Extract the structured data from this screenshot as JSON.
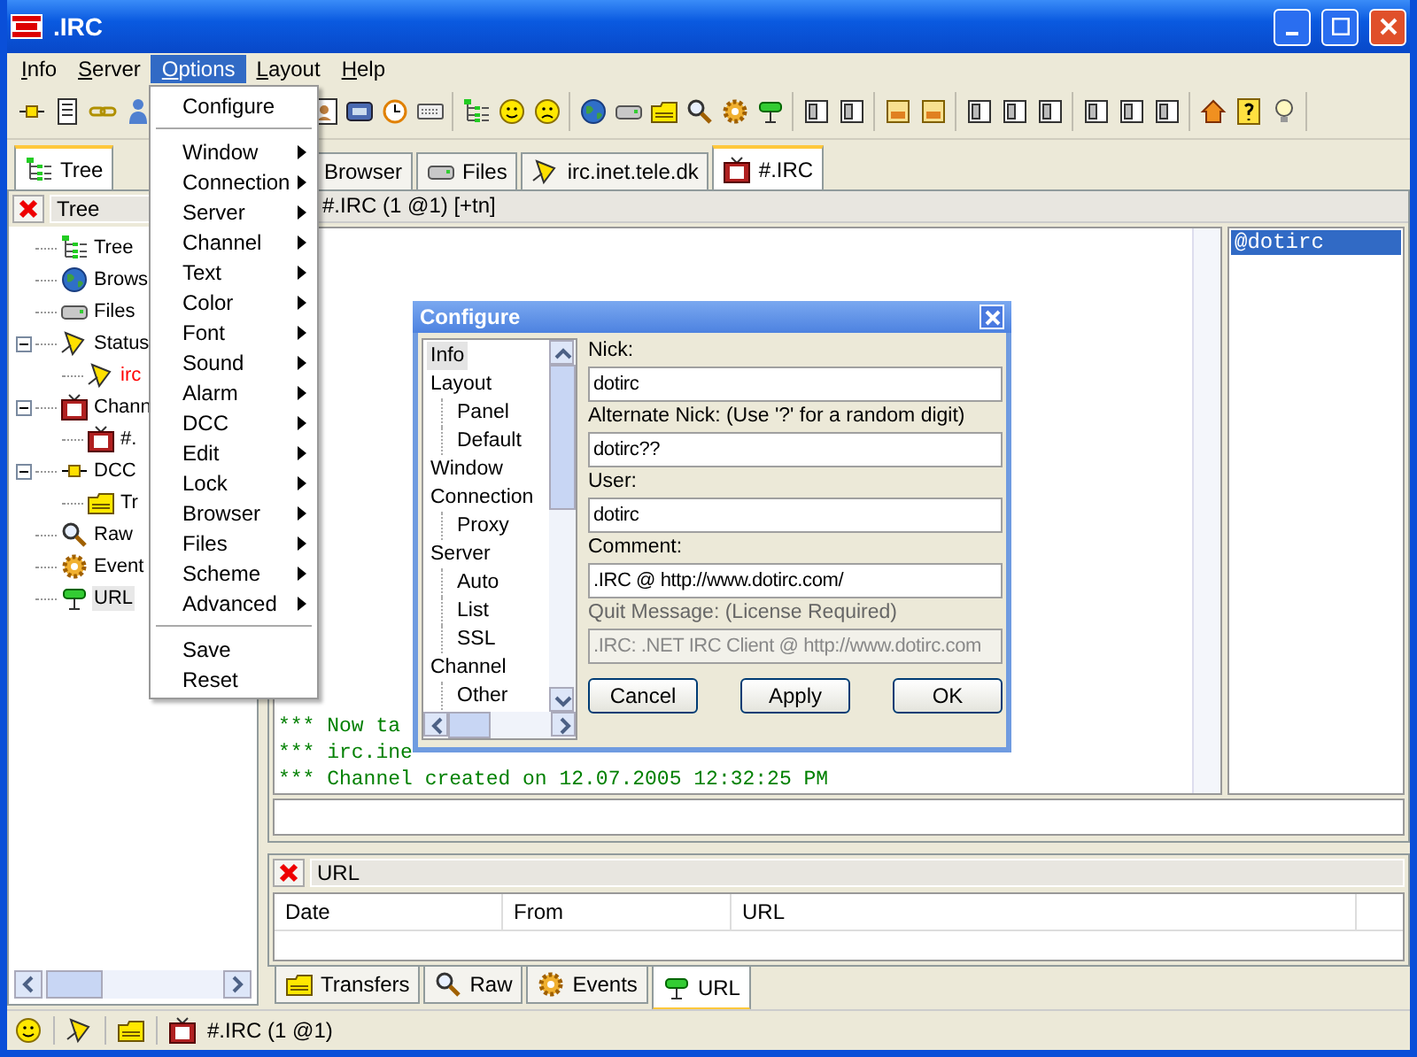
{
  "window": {
    "title": ".IRC"
  },
  "menu_bar": [
    {
      "label": "Info",
      "selected": false
    },
    {
      "label": "Server",
      "selected": false
    },
    {
      "label": "Options",
      "selected": true
    },
    {
      "label": "Layout",
      "selected": false
    },
    {
      "label": "Help",
      "selected": false
    }
  ],
  "options_menu": [
    {
      "kind": "item",
      "label": "Configure",
      "submenu": false
    },
    {
      "kind": "separator"
    },
    {
      "kind": "item",
      "label": "Window",
      "submenu": true
    },
    {
      "kind": "item",
      "label": "Connection",
      "submenu": true
    },
    {
      "kind": "item",
      "label": "Server",
      "submenu": true
    },
    {
      "kind": "item",
      "label": "Channel",
      "submenu": true
    },
    {
      "kind": "item",
      "label": "Text",
      "submenu": true
    },
    {
      "kind": "item",
      "label": "Color",
      "submenu": true
    },
    {
      "kind": "item",
      "label": "Font",
      "submenu": true
    },
    {
      "kind": "item",
      "label": "Sound",
      "submenu": true
    },
    {
      "kind": "item",
      "label": "Alarm",
      "submenu": true
    },
    {
      "kind": "item",
      "label": "DCC",
      "submenu": true
    },
    {
      "kind": "item",
      "label": "Edit",
      "submenu": true
    },
    {
      "kind": "item",
      "label": "Lock",
      "submenu": true
    },
    {
      "kind": "item",
      "label": "Browser",
      "submenu": true
    },
    {
      "kind": "item",
      "label": "Files",
      "submenu": true
    },
    {
      "kind": "item",
      "label": "Scheme",
      "submenu": true
    },
    {
      "kind": "item",
      "label": "Advanced",
      "submenu": true
    },
    {
      "kind": "separator"
    },
    {
      "kind": "item",
      "label": "Save",
      "submenu": false
    },
    {
      "kind": "item",
      "label": "Reset",
      "submenu": false
    }
  ],
  "left_tabs": [
    {
      "label": "Tree",
      "selected": true
    }
  ],
  "tree_panel": {
    "title": "Tree",
    "items": [
      {
        "label": "Tree",
        "color": "#000000",
        "selected": false
      },
      {
        "label": "Brows",
        "color": "#000000",
        "selected": false
      },
      {
        "label": "Files",
        "color": "#000000",
        "selected": false
      },
      {
        "label": "Status",
        "color": "#000000",
        "selected": false,
        "expanded": true,
        "children": [
          {
            "label": "irc",
            "color": "#ff0000",
            "selected": false
          }
        ]
      },
      {
        "label": "Chann",
        "color": "#000000",
        "selected": false,
        "expanded": true,
        "children": [
          {
            "label": "#.",
            "color": "#000000",
            "selected": false
          }
        ]
      },
      {
        "label": "DCC",
        "color": "#000000",
        "selected": false,
        "expanded": true,
        "children": [
          {
            "label": "Tr",
            "color": "#000000",
            "selected": false
          }
        ]
      },
      {
        "label": "Raw",
        "color": "#000000",
        "selected": false
      },
      {
        "label": "Event",
        "color": "#000000",
        "selected": false
      },
      {
        "label": "URL",
        "color": "#000000",
        "selected": true
      }
    ]
  },
  "window_tabs": [
    {
      "label": "Browser",
      "selected": false
    },
    {
      "label": "Files",
      "selected": false
    },
    {
      "label": "irc.inet.tele.dk",
      "selected": false
    },
    {
      "label": "#.IRC",
      "selected": true
    }
  ],
  "channel": {
    "header": "#.IRC (1 @1) [+tn]",
    "messages": [
      "*** Now ta",
      "*** irc.ine",
      "*** Channel created on 12.07.2005 12:32:25 PM"
    ],
    "nicks": [
      {
        "nick": "@dotirc",
        "selected": true
      }
    ]
  },
  "url_panel": {
    "title": "URL",
    "columns": [
      "Date",
      "From",
      "URL"
    ]
  },
  "bottom_tabs": [
    {
      "label": "Transfers",
      "selected": false
    },
    {
      "label": "Raw",
      "selected": false
    },
    {
      "label": "Events",
      "selected": false
    },
    {
      "label": "URL",
      "selected": true
    }
  ],
  "status_bar": {
    "text": "#.IRC (1 @1)"
  },
  "dialog": {
    "title": "Configure",
    "tree": [
      {
        "label": "Info",
        "selected": true
      },
      {
        "label": "Layout",
        "selected": false,
        "children": [
          {
            "label": "Panel",
            "selected": false
          },
          {
            "label": "Default",
            "selected": false
          }
        ]
      },
      {
        "label": "Window",
        "selected": false
      },
      {
        "label": "Connection",
        "selected": false,
        "children": [
          {
            "label": "Proxy",
            "selected": false
          }
        ]
      },
      {
        "label": "Server",
        "selected": false,
        "children": [
          {
            "label": "Auto",
            "selected": false
          },
          {
            "label": "List",
            "selected": false
          },
          {
            "label": "SSL",
            "selected": false
          }
        ]
      },
      {
        "label": "Channel",
        "selected": false,
        "children": [
          {
            "label": "Other",
            "selected": false
          }
        ]
      }
    ],
    "fields": [
      {
        "label": "Nick:",
        "value": "dotirc",
        "disabled": false
      },
      {
        "label": "Alternate Nick: (Use '?' for a random digit)",
        "value": "dotirc??",
        "disabled": false
      },
      {
        "label": "User:",
        "value": "dotirc",
        "disabled": false
      },
      {
        "label": "Comment:",
        "value": ".IRC @ http://www.dotirc.com/",
        "disabled": false
      },
      {
        "label": "Quit Message: (License Required)",
        "value": ".IRC: .NET IRC Client @ http://www.dotirc.com",
        "disabled": true
      }
    ],
    "buttons": [
      "Cancel",
      "Apply",
      "OK"
    ]
  }
}
